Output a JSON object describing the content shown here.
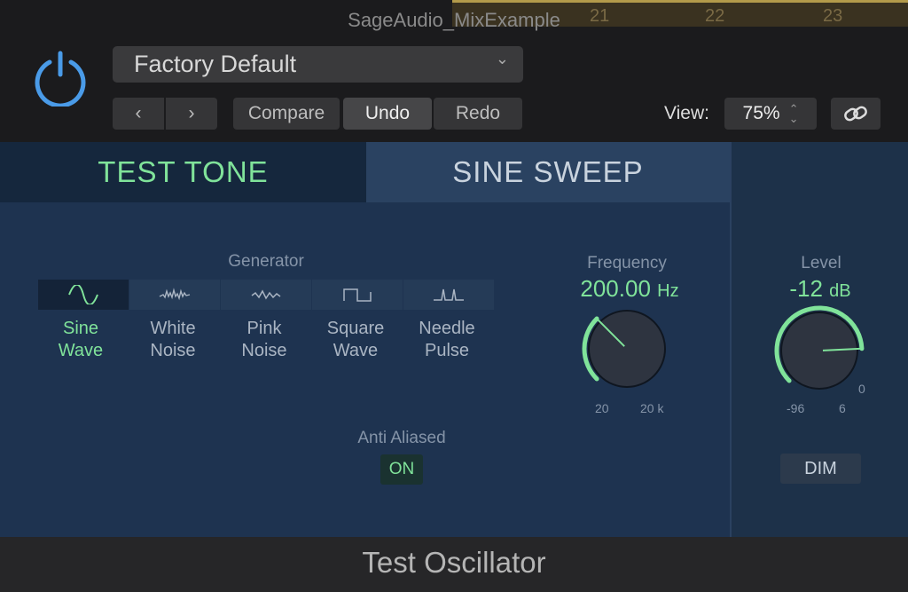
{
  "window": {
    "title": "SageAudio_MixExample",
    "ruler_numbers": [
      "21",
      "22",
      "23"
    ]
  },
  "toolbar": {
    "preset": "Factory Default",
    "prev": "‹",
    "next": "›",
    "compare": "Compare",
    "undo": "Undo",
    "redo": "Redo",
    "view_label": "View:",
    "view_value": "75%"
  },
  "tabs": [
    {
      "label": "TEST TONE",
      "active": true
    },
    {
      "label": "SINE SWEEP",
      "active": false
    }
  ],
  "generator": {
    "label": "Generator",
    "options": [
      {
        "line1": "Sine",
        "line2": "Wave",
        "icon": "sine-wave-icon",
        "selected": true
      },
      {
        "line1": "White",
        "line2": "Noise",
        "icon": "white-noise-icon",
        "selected": false
      },
      {
        "line1": "Pink",
        "line2": "Noise",
        "icon": "pink-noise-icon",
        "selected": false
      },
      {
        "line1": "Square",
        "line2": "Wave",
        "icon": "square-wave-icon",
        "selected": false
      },
      {
        "line1": "Needle",
        "line2": "Pulse",
        "icon": "needle-pulse-icon",
        "selected": false
      }
    ]
  },
  "anti_aliased": {
    "label": "Anti Aliased",
    "value": "ON"
  },
  "frequency": {
    "label": "Frequency",
    "value": "200.00",
    "unit": "Hz",
    "min_label": "20",
    "max_label": "20 k",
    "min": 20,
    "max": 20000,
    "current": 200,
    "scale": "log"
  },
  "level": {
    "label": "Level",
    "value": "-12",
    "unit": "dB",
    "min_label": "-96",
    "max_label": "6",
    "zero_label": "0",
    "min": -96,
    "max": 6,
    "current": -12
  },
  "dim": "DIM",
  "footer": {
    "title": "Test Oscillator"
  },
  "colors": {
    "accent": "#80e39a",
    "panel": "#1e3350",
    "power": "#4a9be8"
  }
}
